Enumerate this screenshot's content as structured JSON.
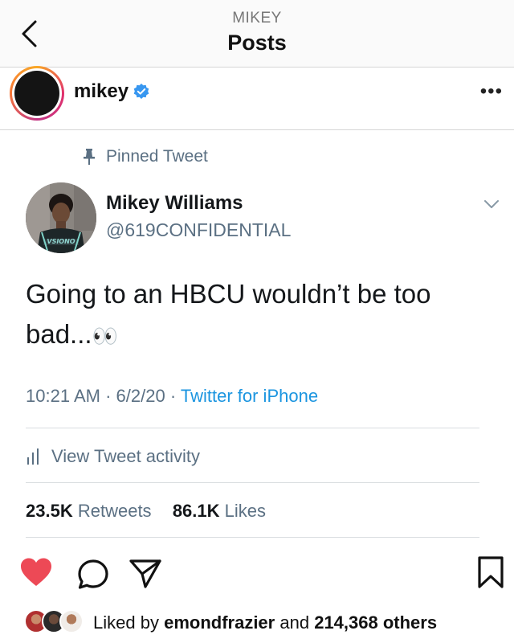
{
  "header": {
    "subtitle": "MIKEY",
    "title": "Posts"
  },
  "post": {
    "username": "mikey",
    "verified": true
  },
  "tweet": {
    "pinned_label": "Pinned Tweet",
    "display_name": "Mikey Williams",
    "handle": "@619CONFIDENTIAL",
    "text_line1": "Going to an HBCU wouldn’t be too",
    "text_line2": "bad...",
    "emoji": "👀",
    "time": "10:21 AM",
    "date": "6/2/20",
    "separator": "·",
    "source": "Twitter for iPhone",
    "activity_label": "View Tweet activity",
    "retweets_count": "23.5K",
    "retweets_label": "Retweets",
    "likes_count": "86.1K",
    "likes_label": "Likes",
    "jersey_text": "VSIONO"
  },
  "likes": {
    "prefix": "Liked by",
    "user": "emondfrazier",
    "middle": "and",
    "others": "214,368 others"
  },
  "colors": {
    "link_blue": "#1b95e0",
    "muted": "#5b7083",
    "heart_red": "#ed4956",
    "verified_blue": "#3897f0"
  },
  "icons": [
    "back-chevron-icon",
    "verified-badge-icon",
    "more-icon",
    "pin-icon",
    "caret-down-icon",
    "activity-icon",
    "heart-icon",
    "comment-icon",
    "share-icon",
    "bookmark-icon"
  ]
}
